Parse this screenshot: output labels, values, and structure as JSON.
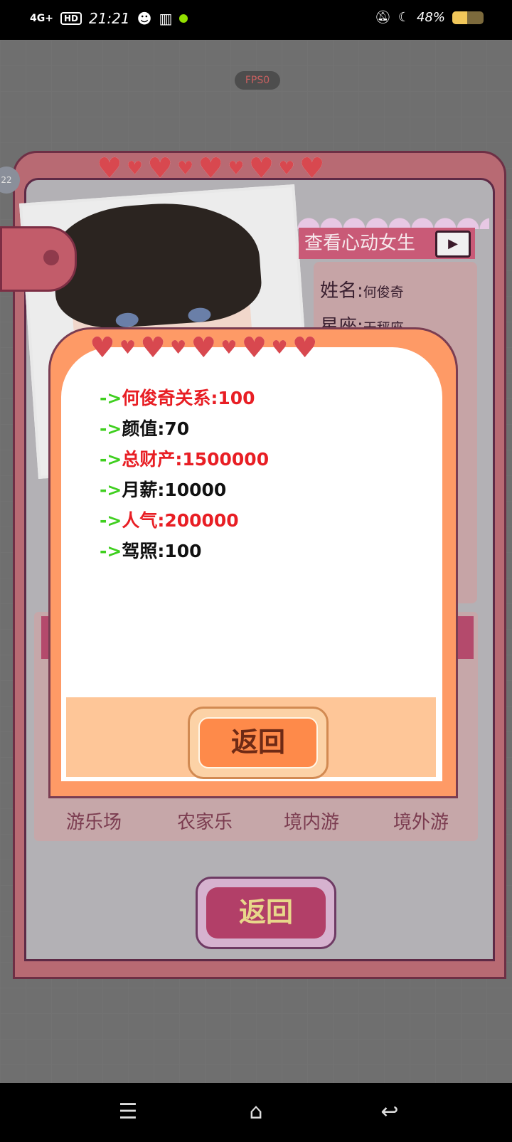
{
  "status_bar": {
    "network": "4G+",
    "hd": "HD",
    "time": "21:21",
    "battery": "48%",
    "battery_level": 0.48
  },
  "fps": "FPS0",
  "card": {
    "banner_title": "查看心动女生",
    "name_label": "姓名:",
    "name_value": "何俊奇",
    "sign_label": "星座:",
    "sign_value": "天秤座",
    "destinations": [
      "游乐场",
      "农家乐",
      "境内游",
      "境外游"
    ],
    "back_label": "返回",
    "side_badge": "22"
  },
  "dialog": {
    "rows": [
      {
        "arrow": "->",
        "text": "何俊奇关系:100",
        "color": "red"
      },
      {
        "arrow": "->",
        "text": "颜值:70",
        "color": "black"
      },
      {
        "arrow": "->",
        "text": "总财产:1500000",
        "color": "red"
      },
      {
        "arrow": "->",
        "text": "月薪:10000",
        "color": "black"
      },
      {
        "arrow": "->",
        "text": "人气:200000",
        "color": "red"
      },
      {
        "arrow": "->",
        "text": "驾照:100",
        "color": "black"
      }
    ],
    "back_label": "返回"
  },
  "colors": {
    "accent_red": "#e81e24",
    "arrow_green": "#3fcf1f",
    "dialog_orange": "#fe9a66",
    "card_pink": "#b86a73"
  }
}
